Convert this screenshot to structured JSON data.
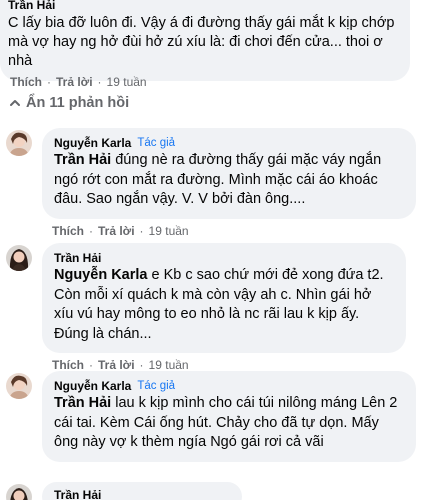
{
  "top_comment": {
    "author": "Trần Hải",
    "text": "C lấy bia đỡ luôn đi. Vậy á đi đường thấy gái mắt k kịp chớp mà vợ hay ng hở đùi hở zú xíu là: đi chơi đến cửa... thoi ơ nhà",
    "like": "Thích",
    "reply": "Trả lời",
    "time": "19 tuần"
  },
  "hide_replies": "Ẩn 11 phản hồi",
  "comments": [
    {
      "author": "Nguyễn Karla",
      "badge": "Tác giả",
      "mention": "Trần Hải",
      "text": " đúng nè ra đường thấy gái mặc váy ngắn ngó rớt con mắt ra đường. Mình mặc cái áo khoác đâu. Sao ngắn vậy. V. V bởi đàn ông....",
      "like": "Thích",
      "reply": "Trả lời",
      "time": "19 tuần"
    },
    {
      "author": "Trần Hải",
      "badge": "",
      "mention": "Nguyễn Karla",
      "text": " e Kb c sao chứ mới đẻ xong đứa t2. Còn mỗi xí quách k mà còn vậy ah c. Nhìn gái hở xíu vú hay mông to eo nhỏ là nc rãi lau k kịp ấy. Đúng là chán...",
      "like": "Thích",
      "reply": "Trả lời",
      "time": "19 tuần"
    },
    {
      "author": "Nguyễn Karla",
      "badge": "Tác giả",
      "mention": "Trần Hải",
      "text": " lau k kịp mình cho cái túi nilông máng Lên 2 cái tai. Kèm Cái ống hút. Chảy cho đã tự dọn. Mấy ông này vợ k thèm ngía Ngó gái rơi cả vãi",
      "like": "Thích",
      "reply": "Trả lời",
      "time": ""
    }
  ],
  "next_comment": {
    "author": "Trần Hải"
  }
}
